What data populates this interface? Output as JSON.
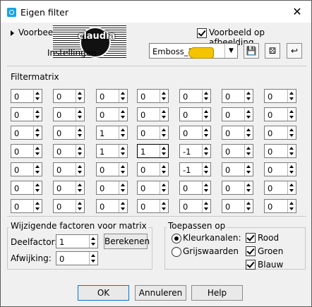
{
  "window": {
    "title": "Eigen filter",
    "close_label": "✕"
  },
  "top": {
    "voorbeeld_label": "Voorbeeld",
    "instellingen_label": "Instellingen",
    "preview_logo_text": "claudia",
    "preview_checkbox_label": "Voorbeeld op afbeelding",
    "preview_checked": true,
    "preset": {
      "selected": "Emboss_3"
    },
    "icons": [
      "save-icon",
      "dice-icon",
      "reset-icon"
    ]
  },
  "matrix": {
    "label": "Filtermatrix",
    "rows": [
      [
        "0",
        "0",
        "0",
        "0",
        "0",
        "0",
        "0"
      ],
      [
        "0",
        "0",
        "0",
        "0",
        "0",
        "0",
        "0"
      ],
      [
        "0",
        "0",
        "1",
        "0",
        "0",
        "0",
        "0"
      ],
      [
        "0",
        "0",
        "1",
        "1",
        "-1",
        "0",
        "0"
      ],
      [
        "0",
        "0",
        "0",
        "0",
        "-1",
        "0",
        "0"
      ],
      [
        "0",
        "0",
        "0",
        "0",
        "0",
        "0",
        "0"
      ],
      [
        "0",
        "0",
        "0",
        "0",
        "0",
        "0",
        "0"
      ]
    ]
  },
  "factors": {
    "label": "Wijzigende factoren voor matrix",
    "deelfactor_label": "Deelfactor:",
    "deelfactor_value": "1",
    "afwijking_label": "Afwijking:",
    "afwijking_value": "0",
    "calc_label": "Berekenen"
  },
  "apply": {
    "label": "Toepassen op",
    "kleur_label": "Kleurkanalen:",
    "grijs_label": "Grijswaarden",
    "kleur_selected": true,
    "rood_label": "Rood",
    "groen_label": "Groen",
    "blauw_label": "Blauw"
  },
  "footer": {
    "ok": "OK",
    "cancel": "Annuleren",
    "help": "Help"
  }
}
